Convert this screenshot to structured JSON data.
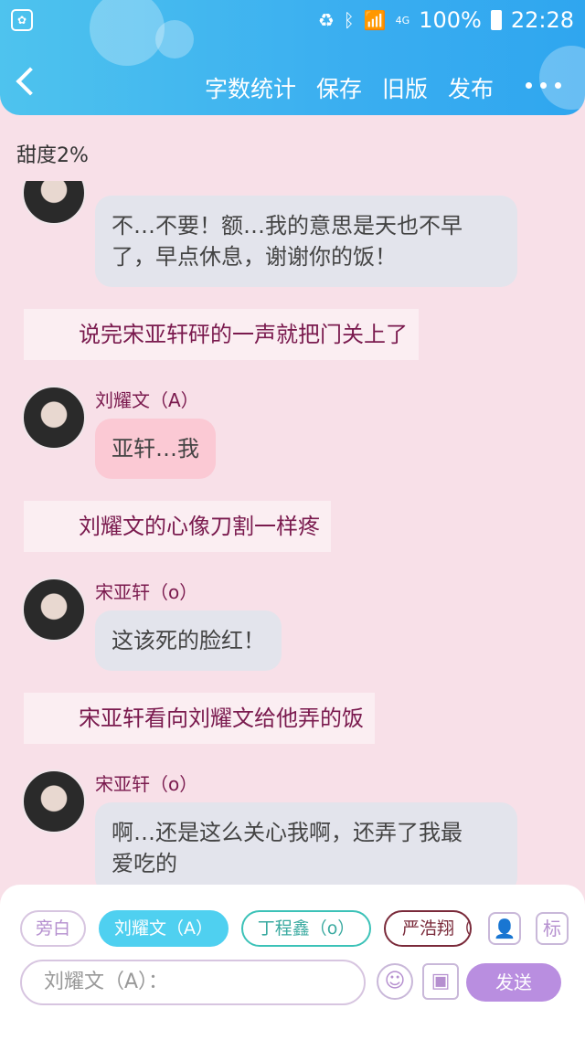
{
  "status": {
    "battery_text": "100%",
    "time": "22:28",
    "network": "4G"
  },
  "header": {
    "actions": [
      "字数统计",
      "保存",
      "旧版",
      "发布"
    ]
  },
  "sweetness": "甜度2%",
  "messages": [
    {
      "type": "chat",
      "speaker": "",
      "text1": "不…不要！额…我的意思是天也不早",
      "text2": "了，早点休息，谢谢你的饭！",
      "style": "grey"
    },
    {
      "type": "narration",
      "text": "说完宋亚轩砰的一声就把门关上了"
    },
    {
      "type": "chat",
      "speaker": "刘耀文（A）",
      "text1": "亚轩…我",
      "style": "pink"
    },
    {
      "type": "narration",
      "text": "刘耀文的心像刀割一样疼"
    },
    {
      "type": "chat",
      "speaker": "宋亚轩（o）",
      "text1": "这该死的脸红！",
      "style": "grey"
    },
    {
      "type": "narration",
      "text": "宋亚轩看向刘耀文给他弄的饭"
    },
    {
      "type": "chat",
      "speaker": "宋亚轩（o）",
      "text1": "啊…还是这么关心我啊，还弄了我最",
      "text2": "爱吃的",
      "style": "grey"
    }
  ],
  "roles": [
    "旁白",
    "刘耀文（A）",
    "丁程鑫（o）",
    "严浩翔（A）"
  ],
  "role_icon_label": "标",
  "input": {
    "placeholder": "刘耀文（A）："
  },
  "send_label": "发送",
  "colors": {
    "header": "#3aaef0",
    "background": "#f8e0e8",
    "send": "#b98ee0",
    "active_role": "#4fd0f0"
  }
}
